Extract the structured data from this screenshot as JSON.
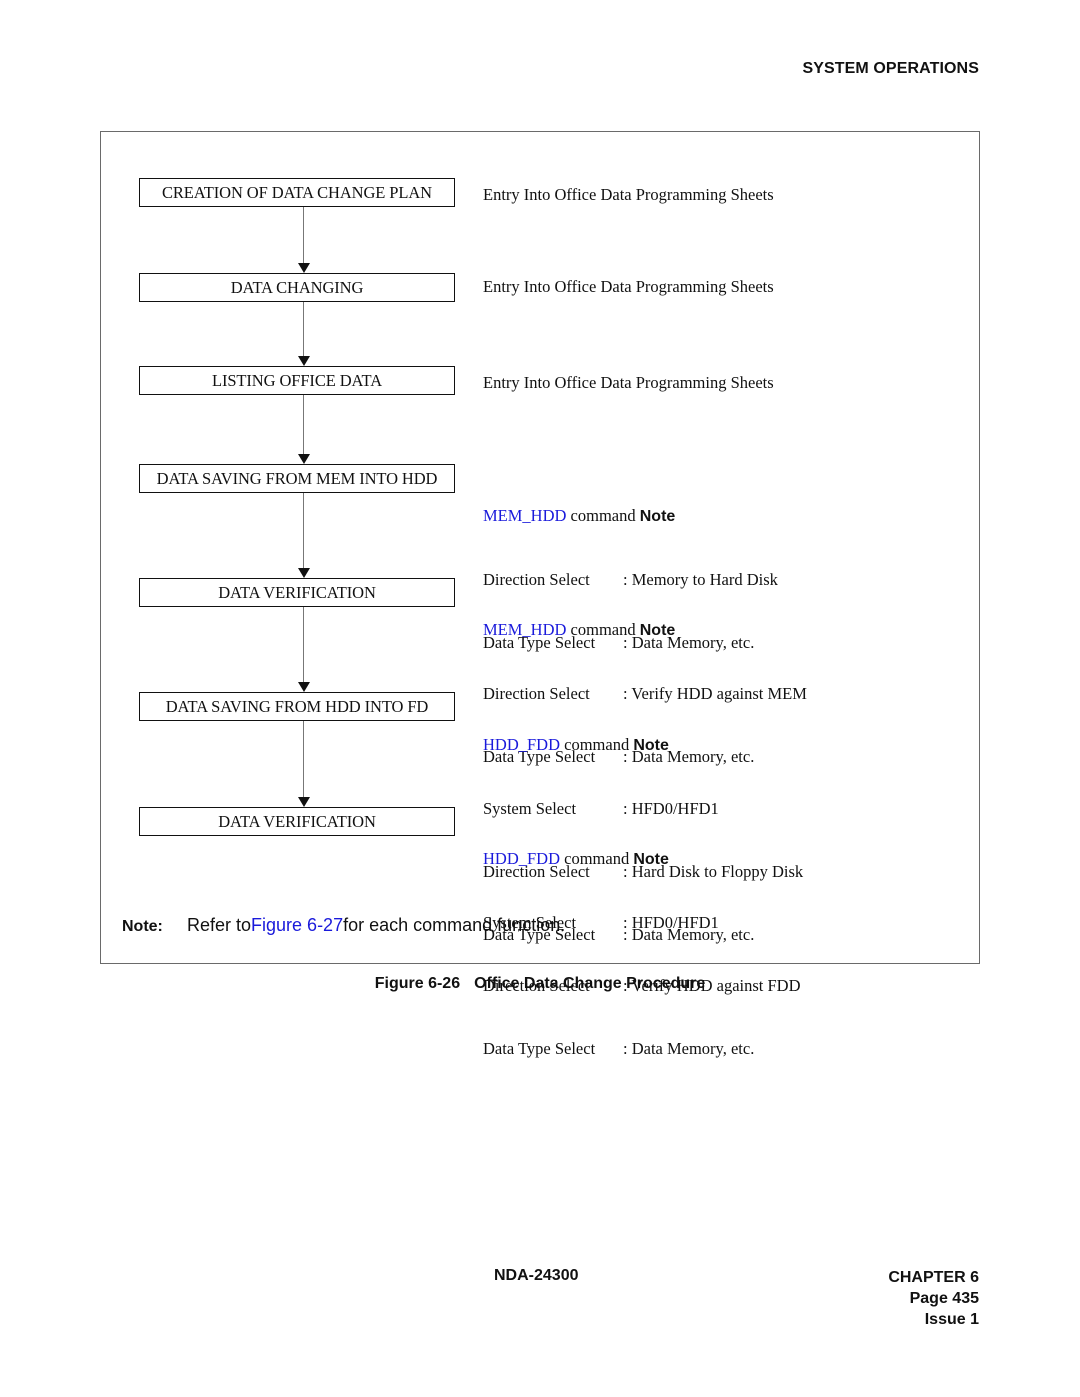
{
  "header": {
    "section_title": "SYSTEM OPERATIONS"
  },
  "flowchart": {
    "steps": [
      {
        "label": "CREATION OF DATA CHANGE PLAN"
      },
      {
        "label": "DATA CHANGING"
      },
      {
        "label": "LISTING OFFICE DATA"
      },
      {
        "label": "DATA SAVING FROM MEM INTO HDD"
      },
      {
        "label": "DATA VERIFICATION"
      },
      {
        "label": "DATA SAVING FROM HDD INTO FD"
      },
      {
        "label": "DATA VERIFICATION"
      }
    ],
    "descriptions": [
      {
        "text": "Entry Into Office Data Programming Sheets"
      },
      {
        "text": "Entry Into Office Data Programming Sheets"
      },
      {
        "text": "Entry Into Office Data Programming Sheets"
      },
      {
        "command": "MEM_HDD",
        "command_suffix": " command ",
        "note": "Note",
        "lines": [
          {
            "label": "Direction Select",
            "value": ": Memory to Hard Disk"
          },
          {
            "label": "Data Type Select",
            "value": ": Data Memory, etc."
          }
        ]
      },
      {
        "command": "MEM_HDD",
        "command_suffix": " command ",
        "note": "Note",
        "lines": [
          {
            "label": "Direction Select",
            "value": ": Verify HDD against MEM"
          },
          {
            "label": "Data Type Select",
            "value": ": Data Memory, etc."
          }
        ]
      },
      {
        "command": "HDD_FDD",
        "command_suffix": " command ",
        "note": "Note",
        "lines": [
          {
            "label": "System Select",
            "value": ": HFD0/HFD1"
          },
          {
            "label": "Direction Select",
            "value": ": Hard Disk to Floppy Disk"
          },
          {
            "label": "Data Type Select",
            "value": ": Data Memory, etc."
          }
        ]
      },
      {
        "command": "HDD_FDD",
        "command_suffix": " command ",
        "note": "Note",
        "lines": [
          {
            "label": "System Select",
            "value": ": HFD0/HFD1"
          },
          {
            "label": "Direction Select",
            "value": ": Verify HDD against FDD"
          },
          {
            "label": "Data Type Select",
            "value": ": Data Memory, etc."
          }
        ]
      }
    ]
  },
  "footnote": {
    "label": "Note:",
    "prefix": "Refer to",
    "link": "Figure 6-27",
    "suffix": "for each command function."
  },
  "caption": {
    "number": "Figure 6-26",
    "title": "Office Data Change Procedure"
  },
  "footer": {
    "doc_id": "NDA-24300",
    "chapter": "CHAPTER 6",
    "page": "Page 435",
    "issue": "Issue 1"
  },
  "colors": {
    "link": "#1a1adb",
    "text": "#111111",
    "frame": "#6a6a6a"
  }
}
